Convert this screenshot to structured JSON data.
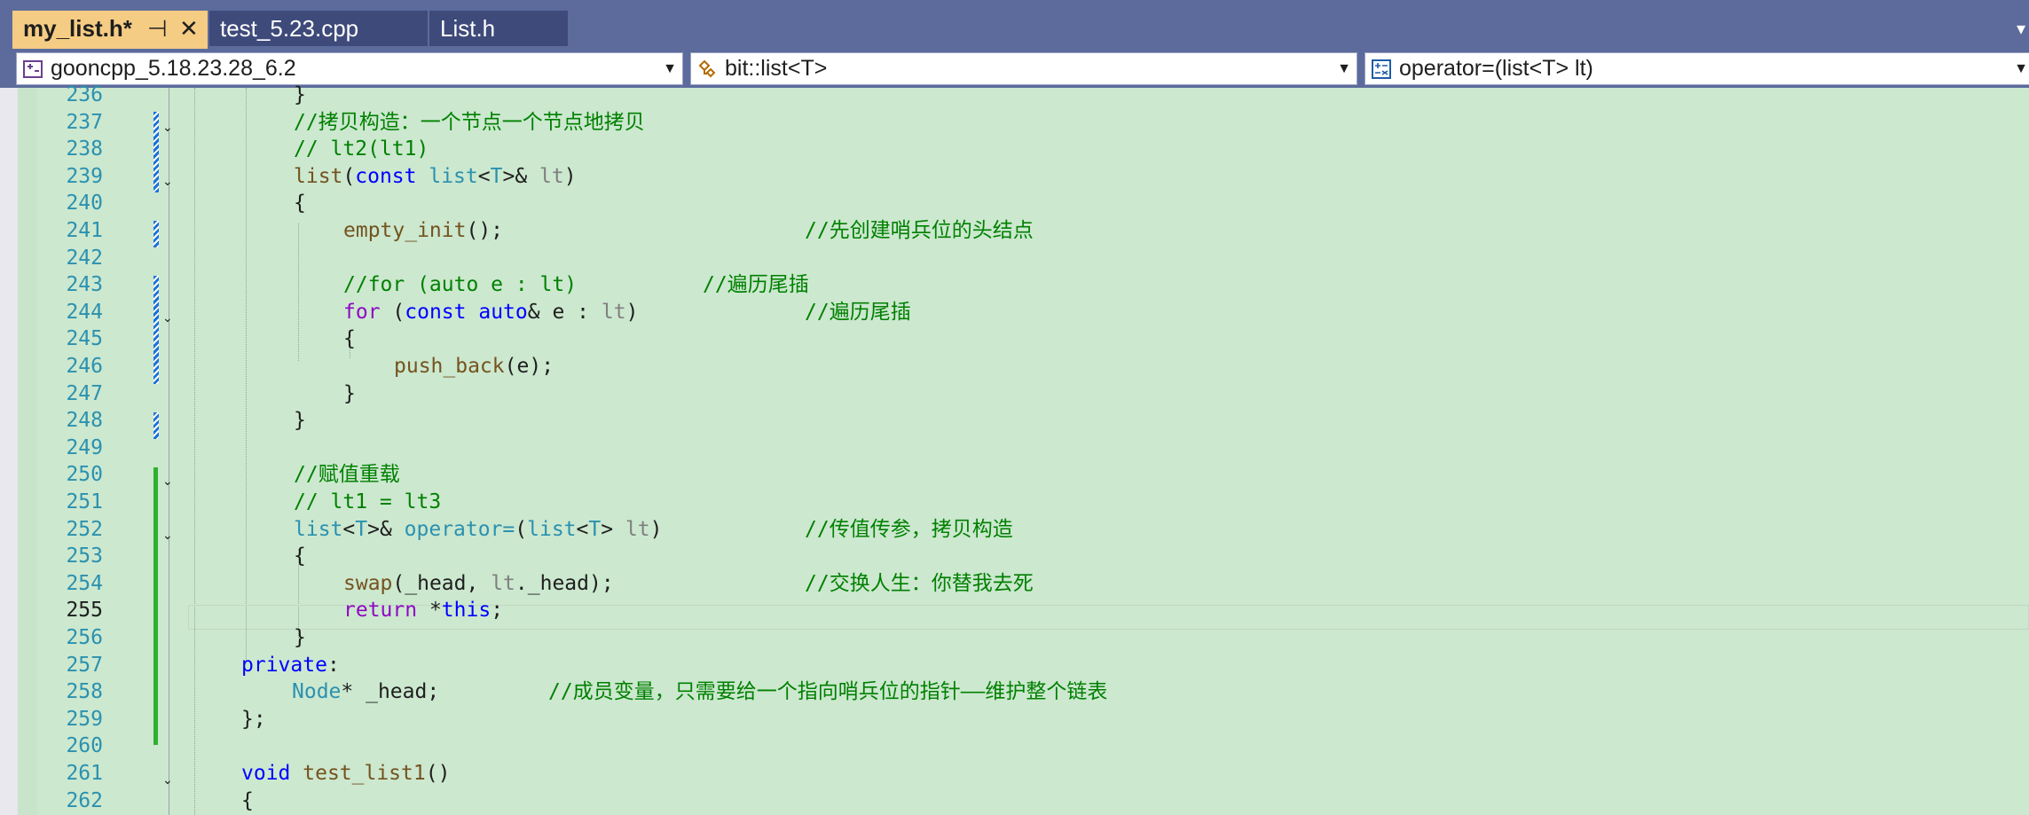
{
  "tabs": [
    {
      "label": "my_list.h*",
      "active": true,
      "pin": "⊣",
      "close": "✕"
    },
    {
      "label": "test_5.23.cpp",
      "active": false
    },
    {
      "label": "List.h",
      "active": false
    }
  ],
  "navbar": {
    "project": "gooncpp_5.18.23.28_6.2",
    "scope": "bit::list<T>",
    "member": "operator=(list<T> lt)"
  },
  "editor": {
    "current_line": "255",
    "lines": [
      {
        "n": "236"
      },
      {
        "n": "237",
        "comment": "//拷贝构造：一个节点一个节点地拷贝"
      },
      {
        "n": "238",
        "comment": "// lt2(lt1)"
      },
      {
        "n": "239"
      },
      {
        "n": "240"
      },
      {
        "n": "241",
        "comment": "//先创建哨兵位的头结点"
      },
      {
        "n": "242"
      },
      {
        "n": "243",
        "comment": "//for (auto e : lt)",
        "comment2": "//遍历尾插"
      },
      {
        "n": "244",
        "comment": "//遍历尾插"
      },
      {
        "n": "245"
      },
      {
        "n": "246"
      },
      {
        "n": "247"
      },
      {
        "n": "248"
      },
      {
        "n": "249"
      },
      {
        "n": "250",
        "comment": "//赋值重载"
      },
      {
        "n": "251",
        "comment": "// lt1 = lt3"
      },
      {
        "n": "252",
        "comment": "//传值传参，拷贝构造"
      },
      {
        "n": "253"
      },
      {
        "n": "254",
        "comment": "//交换人生：你替我去死"
      },
      {
        "n": "255"
      },
      {
        "n": "256"
      },
      {
        "n": "257"
      },
      {
        "n": "258",
        "comment": "//成员变量，只需要给一个指向哨兵位的指针——维护整个链表"
      },
      {
        "n": "259"
      },
      {
        "n": "260"
      },
      {
        "n": "261"
      },
      {
        "n": "262"
      }
    ],
    "tokens": {
      "close_brace": "}",
      "open_brace": "{",
      "list": "list",
      "const": "const",
      "T": "T",
      "lt": "lt",
      "empty_init": "empty_init",
      "for": "for",
      "auto": "auto",
      "e": "e",
      "push_back": "push_back",
      "operator_eq": "operator=",
      "swap": "swap",
      "_head": "_head",
      "return": "return",
      "this": "this",
      "private": "private",
      "Node": "Node",
      "void": "void",
      "test_list1": "test_list1",
      "end_class": "};"
    }
  },
  "colors": {
    "editor_bg": "#cce8cf",
    "tab_active": "#f5cc84",
    "tab_inactive": "#3e4a7a",
    "chrome": "#5c6b9c",
    "comment": "#008000",
    "keyword": "#0000ff",
    "control_keyword": "#8f08c4",
    "type": "#2b91af",
    "function": "#74531f",
    "parameter": "#808080",
    "line_number": "#2b91af"
  }
}
